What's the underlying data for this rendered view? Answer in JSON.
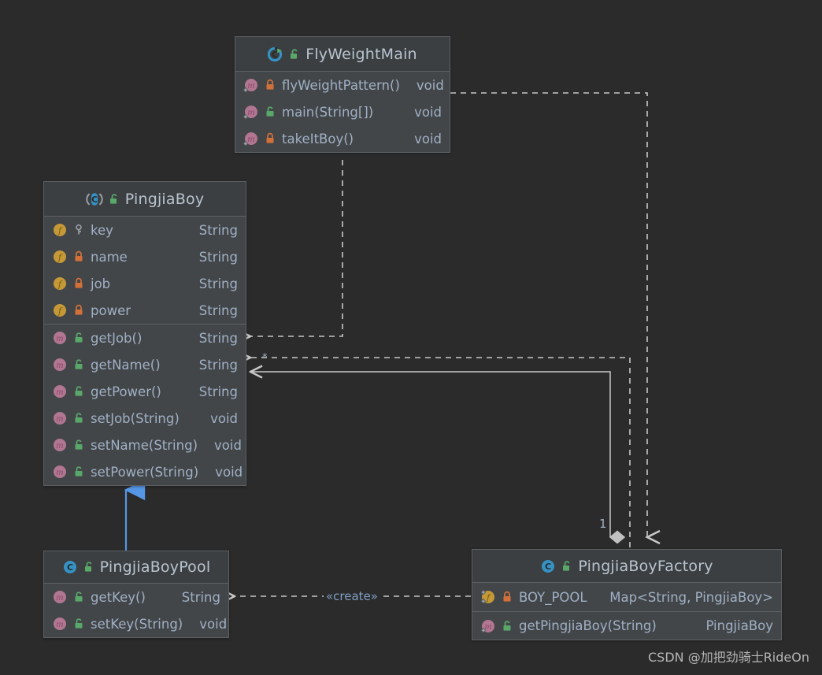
{
  "diagram": {
    "type": "uml-class-diagram",
    "background": "#2b2b2b",
    "box_fill": "#434649",
    "box_header_fill": "#3c3f41",
    "border_color": "#5c6164",
    "text_color": "#9fb0c4",
    "inheritance_color": "#5596e6",
    "wire_color": "#c8c8c8"
  },
  "classes": {
    "flyweightmain": {
      "name": "FlyWeightMain",
      "icon": "runnable-class-icon",
      "visibility_icon": "unlocked-green-icon",
      "members": [
        {
          "icon": "method-icon",
          "vis": "locked-orange-icon",
          "name": "flyWeightPattern()",
          "type": "void"
        },
        {
          "icon": "method-icon",
          "vis": "unlocked-green-icon",
          "name": "main(String[])",
          "type": "void"
        },
        {
          "icon": "method-icon",
          "vis": "locked-orange-icon",
          "name": "takeItBoy()",
          "type": "void"
        }
      ]
    },
    "pingjiaboy": {
      "name": "PingjiaBoy",
      "icon": "abstract-class-icon",
      "visibility_icon": "unlocked-green-icon",
      "fields": [
        {
          "icon": "field-icon",
          "vis": "key-icon",
          "name": "key",
          "type": "String"
        },
        {
          "icon": "field-icon",
          "vis": "locked-orange-icon",
          "name": "name",
          "type": "String"
        },
        {
          "icon": "field-icon",
          "vis": "locked-orange-icon",
          "name": "job",
          "type": "String"
        },
        {
          "icon": "field-icon",
          "vis": "locked-orange-icon",
          "name": "power",
          "type": "String"
        }
      ],
      "methods": [
        {
          "icon": "method-icon",
          "vis": "unlocked-green-icon",
          "name": "getJob()",
          "type": "String"
        },
        {
          "icon": "method-icon",
          "vis": "unlocked-green-icon",
          "name": "getName()",
          "type": "String"
        },
        {
          "icon": "method-icon",
          "vis": "unlocked-green-icon",
          "name": "getPower()",
          "type": "String"
        },
        {
          "icon": "method-icon",
          "vis": "unlocked-green-icon",
          "name": "setJob(String)",
          "type": "void"
        },
        {
          "icon": "method-icon",
          "vis": "unlocked-green-icon",
          "name": "setName(String)",
          "type": "void"
        },
        {
          "icon": "method-icon",
          "vis": "unlocked-green-icon",
          "name": "setPower(String)",
          "type": "void"
        }
      ]
    },
    "pingjiaboypool": {
      "name": "PingjiaBoyPool",
      "icon": "class-icon",
      "visibility_icon": "unlocked-green-icon",
      "members": [
        {
          "icon": "method-icon",
          "vis": "unlocked-green-icon",
          "name": "getKey()",
          "type": "String"
        },
        {
          "icon": "method-icon",
          "vis": "unlocked-green-icon",
          "name": "setKey(String)",
          "type": "void"
        }
      ]
    },
    "pingjiaboyfactory": {
      "name": "PingjiaBoyFactory",
      "icon": "class-icon",
      "visibility_icon": "unlocked-green-icon",
      "members": [
        {
          "icon": "static-field-icon",
          "vis": "locked-orange-icon",
          "name": "BOY_POOL",
          "type": "Map<String, PingjiaBoy>"
        },
        {
          "icon": "static-method-icon",
          "vis": "unlocked-green-icon",
          "name": "getPingjiaBoy(String)",
          "type": "PingjiaBoy"
        }
      ]
    }
  },
  "connectors": {
    "create_label": "«create»",
    "mult_one": "1",
    "mult_many": "*"
  },
  "watermark": "CSDN @加把劲骑士RideOn"
}
